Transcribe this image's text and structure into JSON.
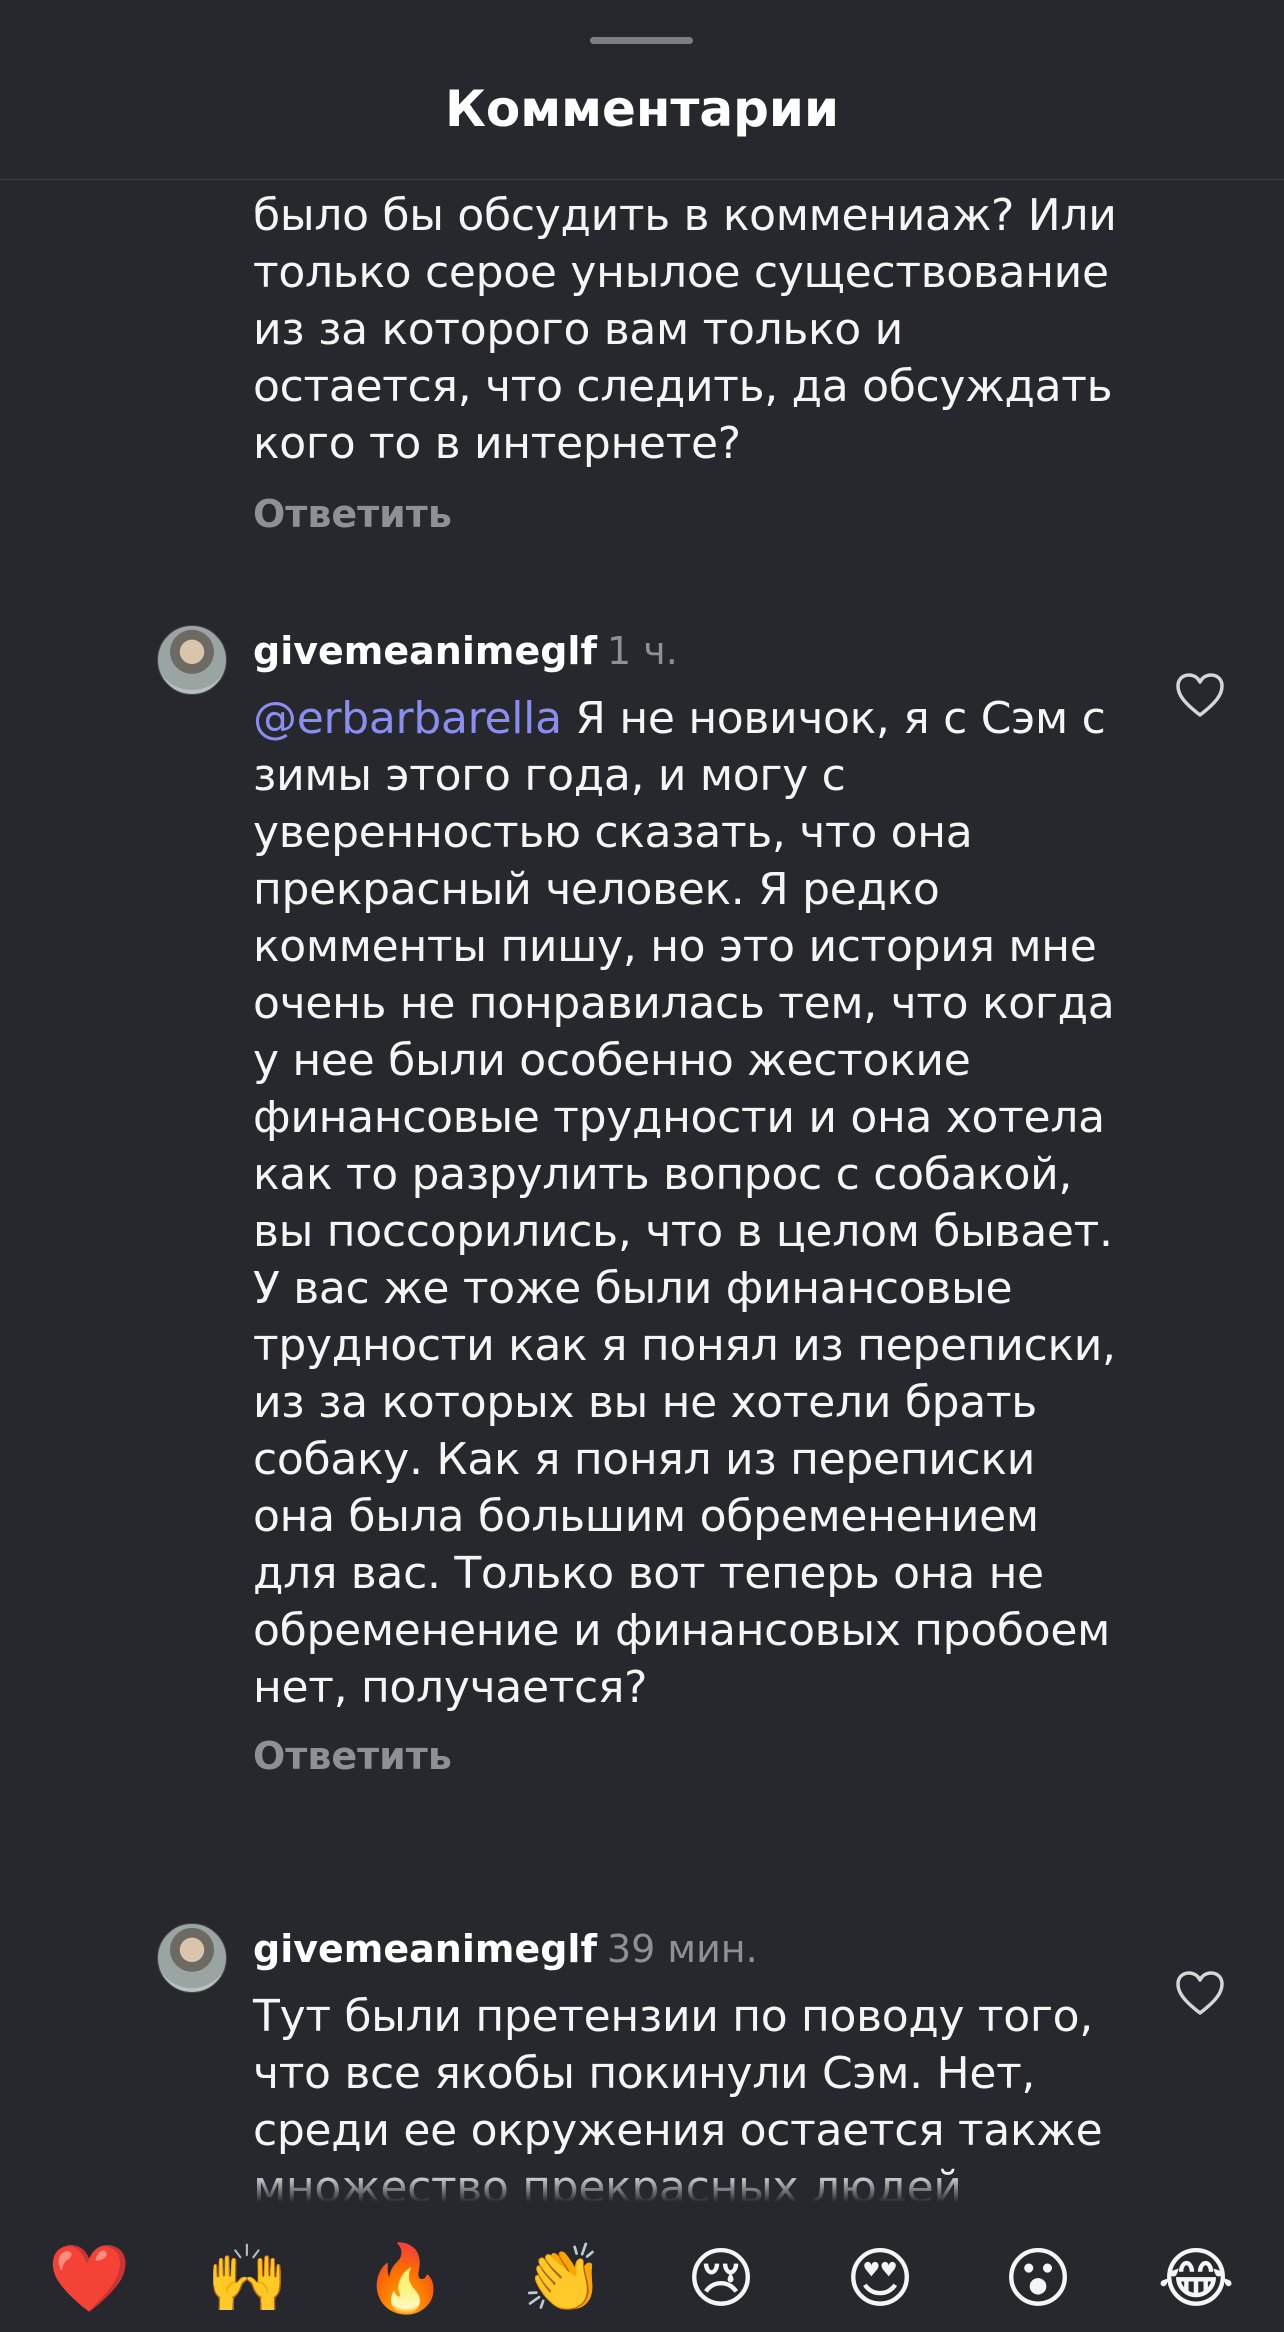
{
  "header": {
    "title": "Комментарии"
  },
  "comments": [
    {
      "partial_text_lines": [
        "было бы обсудить в коммениаж? Или",
        "только серое унылое существование",
        "из за которого вам только и",
        "остается, что следить, да обсуждать",
        "кого то в интернете?"
      ],
      "reply_label": "Ответить"
    },
    {
      "username": "givemeanimeglf",
      "time": "1 ч.",
      "mention": "@erbarbarella",
      "text_lines": [
        " Я не новичок, я с Сэм с",
        "зимы этого года, и могу с",
        "уверенностью сказать, что она",
        "прекрасный человек. Я редко",
        "комменты пишу, но это история мне",
        "очень не понравилась тем, что когда",
        "у нее были особенно жестокие",
        "финансовые трудности и она хотела",
        "как то разрулить вопрос с собакой,",
        "вы поссорились, что в целом бывает.",
        "У вас же тоже были финансовые",
        "трудности как я понял из переписки,",
        "из за которых вы не хотели брать",
        "собаку. Как я понял из переписки",
        "она была большим обременением",
        "для вас. Только вот теперь она не",
        "обременение и финансовых пробоем",
        "нет, получается?"
      ],
      "reply_label": "Ответить"
    },
    {
      "username": "givemeanimeglf",
      "time": "39 мин.",
      "text_lines": [
        "Тут были претензии по поводу того,",
        "что все якобы покинули Сэм. Нет,",
        "среди ее окружения остается также",
        "множество прекрасных людей"
      ]
    }
  ],
  "reactions": [
    "❤️",
    "🙌",
    "🔥",
    "👏",
    "😢",
    "😍",
    "😮",
    "😂"
  ]
}
